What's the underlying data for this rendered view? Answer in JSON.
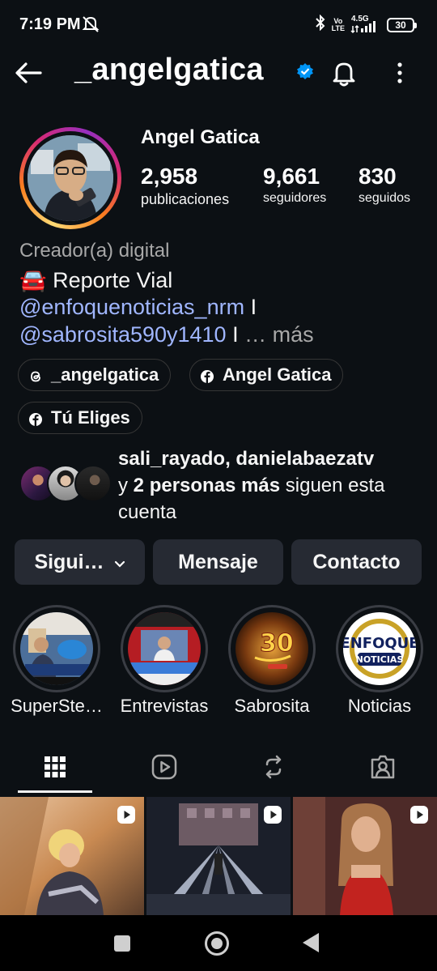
{
  "status": {
    "time": "7:19 PM",
    "network_top": "Vo",
    "network_bottom": "LTE",
    "signal": "4.5G",
    "battery": "30"
  },
  "header": {
    "username": "_angelgatica",
    "verified": true
  },
  "profile": {
    "full_name": "Angel Gatica",
    "stats": [
      {
        "value": "2,958",
        "label": "publicaciones"
      },
      {
        "value": "9,661",
        "label": "seguidores"
      },
      {
        "value": "830",
        "label": "seguidos"
      }
    ],
    "category": "Creador(a) digital",
    "bio": {
      "line1": "🚘 Reporte Vial",
      "mention1": "@enfoquenoticias_nrm",
      "sep1": " I",
      "mention2": "@sabrosita590y1410",
      "sep2": " I",
      "more": "… más"
    },
    "links": [
      {
        "icon": "threads-icon",
        "label": "_angelgatica"
      },
      {
        "icon": "facebook-icon",
        "label": "Angel Gatica"
      },
      {
        "icon": "facebook-icon",
        "label": "Tú Eliges"
      }
    ],
    "mutual": {
      "names": "sali_rayado, danielabaezatv",
      "prefix": "y ",
      "others": "2 personas más",
      "suffix": " siguen esta cuenta"
    }
  },
  "actions": {
    "follow_label": "Sigui…",
    "message_label": "Mensaje",
    "contact_label": "Contacto"
  },
  "highlights": [
    {
      "label": "SuperSte…"
    },
    {
      "label": "Entrevistas"
    },
    {
      "label": "Sabrosita",
      "art_text": "30"
    },
    {
      "label": "Noticias",
      "art_line1": "ENFOQUE",
      "art_line2": "NOTICIAS"
    }
  ],
  "tabs": [
    {
      "icon": "grid-icon",
      "active": true
    },
    {
      "icon": "reels-icon",
      "active": false
    },
    {
      "icon": "reposts-icon",
      "active": false
    },
    {
      "icon": "tagged-icon",
      "active": false
    }
  ],
  "colors": {
    "background": "#0c1014",
    "mention": "#a0b6ff",
    "button": "#262a33",
    "verified": "#0095f6"
  }
}
